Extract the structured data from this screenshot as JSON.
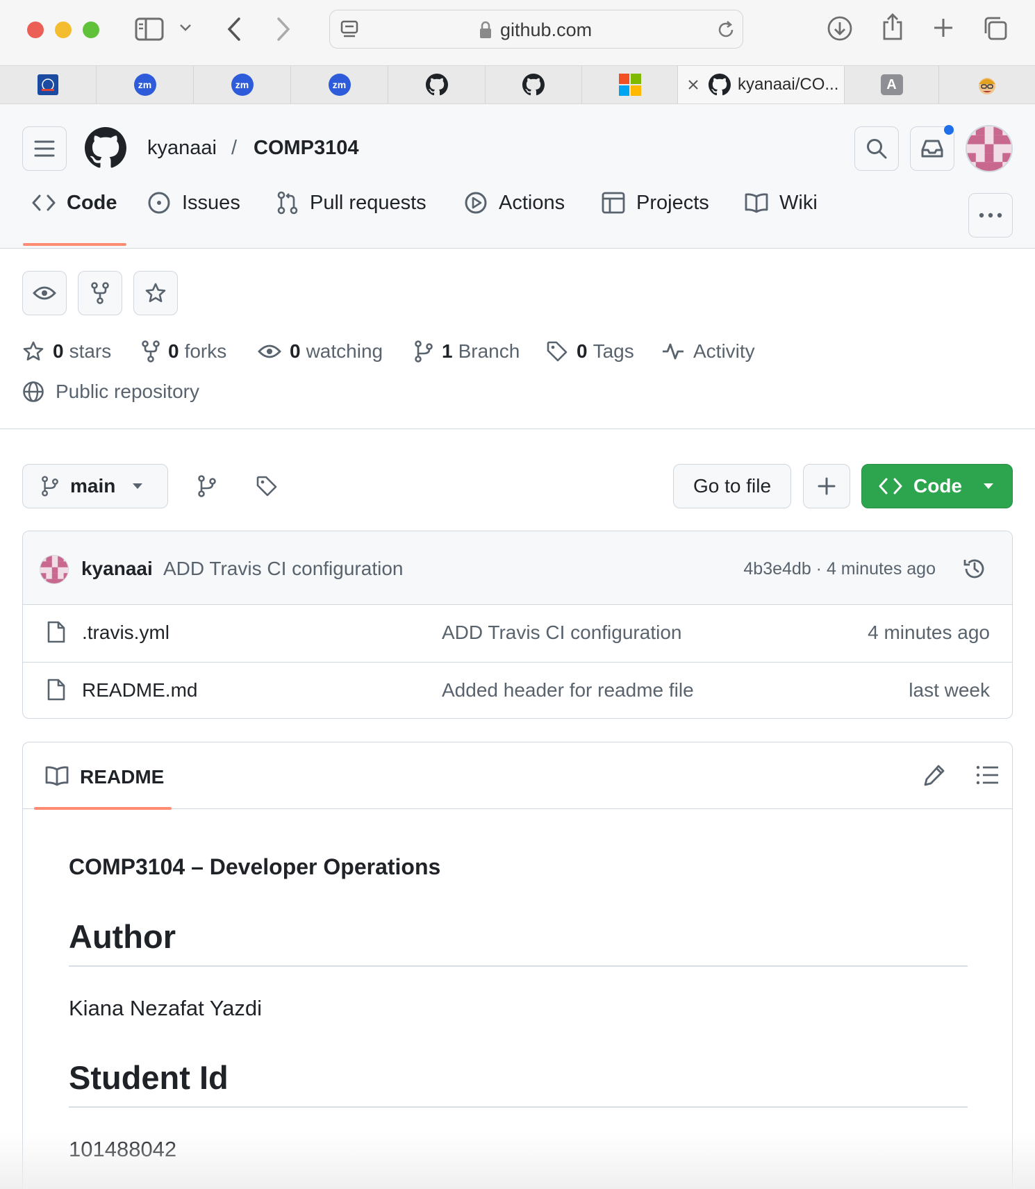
{
  "browser": {
    "url": "github.com",
    "active_tab_title": "kyanaai/CO...",
    "tab_letter": "A",
    "zoom_label": "zm"
  },
  "repo": {
    "owner": "kyanaai",
    "separator": "/",
    "name": "COMP3104"
  },
  "nav": {
    "code": "Code",
    "issues": "Issues",
    "pulls": "Pull requests",
    "actions": "Actions",
    "projects": "Projects",
    "wiki": "Wiki"
  },
  "meta": {
    "stars_count": "0",
    "stars_label": "stars",
    "forks_count": "0",
    "forks_label": "forks",
    "watching_count": "0",
    "watching_label": "watching",
    "branch_count": "1",
    "branch_label": "Branch",
    "tags_count": "0",
    "tags_label": "Tags",
    "activity_label": "Activity",
    "visibility": "Public repository"
  },
  "toolbar": {
    "branch": "main",
    "go_to_file": "Go to file",
    "code_button": "Code"
  },
  "latest_commit": {
    "author": "kyanaai",
    "message": "ADD Travis CI configuration",
    "hash_time": "4b3e4db · 4 minutes ago"
  },
  "files": [
    {
      "name": ".travis.yml",
      "message": "ADD Travis CI configuration",
      "time": "4 minutes ago"
    },
    {
      "name": "README.md",
      "message": "Added header for readme file",
      "time": "last week"
    }
  ],
  "readme": {
    "tab_label": "README",
    "title": "COMP3104 – Developer Operations",
    "h_author": "Author",
    "author_name": "Kiana Nezafat Yazdi",
    "h_student": "Student Id",
    "student_id": "101488042"
  },
  "colors": {
    "accent_green": "#2da44e",
    "tab_underline": "#fd8c73",
    "notification_blue": "#1f6feb"
  }
}
